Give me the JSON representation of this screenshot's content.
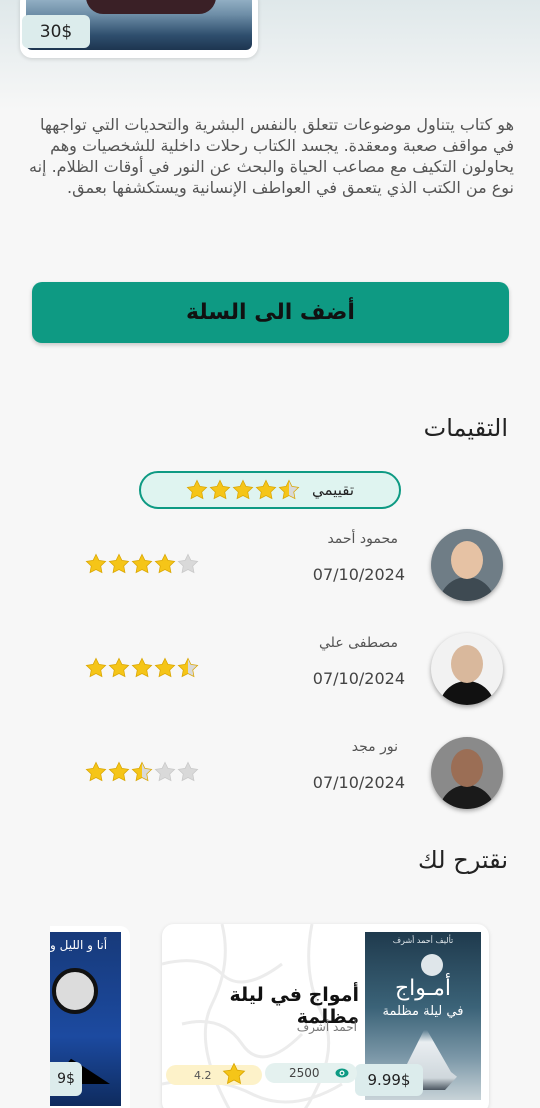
{
  "hero": {
    "price": "30$"
  },
  "description": "هو كتاب يتناول موضوعات تتعلق بالنفس البشرية والتحديات التي تواجهها في مواقف صعبة ومعقدة. يجسد الكتاب رحلات داخلية للشخصيات وهم يحاولون التكيف مع مصاعب الحياة والبحث عن النور في أوقات الظلام. إنه نوع من الكتب الذي يتعمق في العواطف الإنسانية ويستكشفها بعمق.",
  "add_to_cart": "أضف الى السلة",
  "ratings_title": "التقيمات",
  "my_rating": {
    "label": "تقييمي",
    "stars": 4.5
  },
  "reviews": [
    {
      "name": "محمود أحمد",
      "date": "07/10/2024",
      "stars": 4
    },
    {
      "name": "مصطفى علي",
      "date": "07/10/2024",
      "stars": 4.5
    },
    {
      "name": "نور مجد",
      "date": "07/10/2024",
      "stars": 2.5
    }
  ],
  "suggest_title": "نقترح لك",
  "suggestions": [
    {
      "title": "أمواج في ليلة مظلمة",
      "author": "أحمد أشرف",
      "price": "9.99$",
      "views": "2500",
      "rating": "4.2",
      "cover_title": "أمـواج",
      "cover_subtitle": "في ليلة مظلمة",
      "cover_author": "تأليف أحمد أشرف"
    },
    {
      "price": "9$",
      "cover_title": "أنا و الليل و"
    }
  ],
  "colors": {
    "accent": "#0e9a83",
    "star": "#f5c518",
    "star_empty": "#d9d9d9"
  }
}
